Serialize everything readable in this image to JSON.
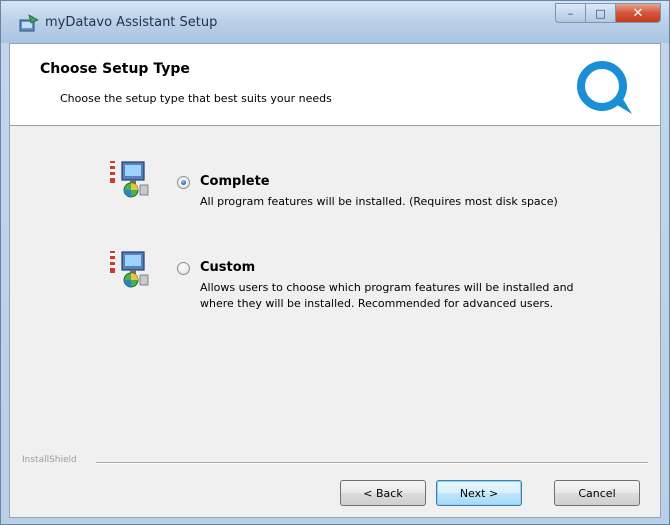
{
  "window": {
    "title": "myDatavo Assistant Setup",
    "controls": {
      "minimize": "–",
      "maximize": "□",
      "close": "✕"
    }
  },
  "banner": {
    "title": "Choose Setup Type",
    "subtitle": "Choose the setup type that best suits your needs",
    "logo_icon": "speech-bubble-logo-icon"
  },
  "options": [
    {
      "label": "Complete",
      "description": "All program features will be installed.  (Requires most disk space)",
      "selected": true,
      "icon": "complete-setup-icon"
    },
    {
      "label": "Custom",
      "description": "Allows users to choose which program features will be installed and where they will be installed. Recommended for advanced users.",
      "selected": false,
      "icon": "custom-setup-icon"
    }
  ],
  "footer": {
    "brand": "InstallShield",
    "back_label": "< Back",
    "next_label": "Next >",
    "cancel_label": "Cancel"
  },
  "colors": {
    "accent": "#1a8fd6",
    "title_bar": "#bdd2ea",
    "close_button": "#c23a1e"
  }
}
